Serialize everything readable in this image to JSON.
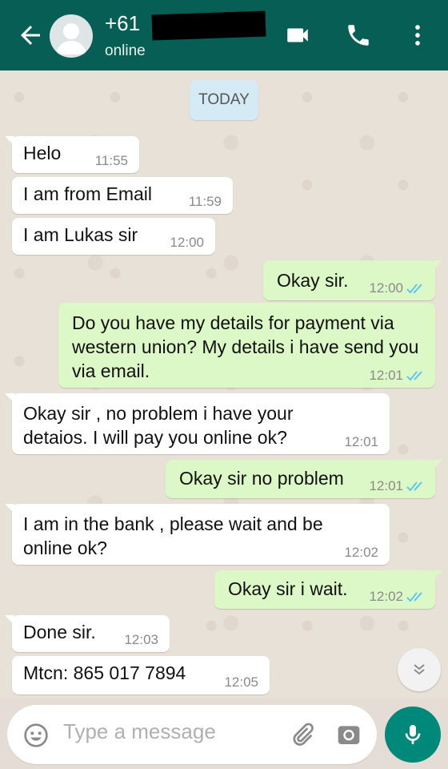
{
  "header": {
    "contact_name": "+61 ",
    "status": "online",
    "icons": [
      "back-arrow-icon",
      "avatar-placeholder-icon",
      "video-call-icon",
      "phone-icon",
      "more-vertical-icon"
    ]
  },
  "chat": {
    "date_chip": "TODAY",
    "messages": [
      {
        "text": "Helo",
        "time": "11:55",
        "direction": "in"
      },
      {
        "text": "I am from Email",
        "time": "11:59",
        "direction": "in"
      },
      {
        "text": "I am Lukas sir",
        "time": "12:00",
        "direction": "in"
      },
      {
        "text": "Okay sir.",
        "time": "12:00",
        "direction": "out",
        "read": true
      },
      {
        "text": "Do you have my details for payment via western union? My details i have send you via email.",
        "time": "12:01",
        "direction": "out",
        "read": true
      },
      {
        "text": "Okay sir , no problem i have your detaios. I will pay you online ok?",
        "time": "12:01",
        "direction": "in"
      },
      {
        "text": "Okay sir no problem",
        "time": "12:01",
        "direction": "out",
        "read": true
      },
      {
        "text": "I am in the bank , please wait and be online ok?",
        "time": "12:02",
        "direction": "in"
      },
      {
        "text": "Okay sir i wait.",
        "time": "12:02",
        "direction": "out",
        "read": true
      },
      {
        "text": "Done sir.",
        "time": "12:03",
        "direction": "in"
      },
      {
        "text": "Mtcn: 865 017 7894",
        "time": "12:05",
        "direction": "in"
      }
    ]
  },
  "composer": {
    "placeholder": "Type a message",
    "icons": [
      "emoji-icon",
      "attach-icon",
      "camera-icon",
      "mic-icon"
    ]
  },
  "colors": {
    "header": "#075e54",
    "outgoing_bubble": "#dcf8c6",
    "incoming_bubble": "#ffffff",
    "read_tick": "#4fc3f7",
    "mic_button": "#00897b"
  }
}
